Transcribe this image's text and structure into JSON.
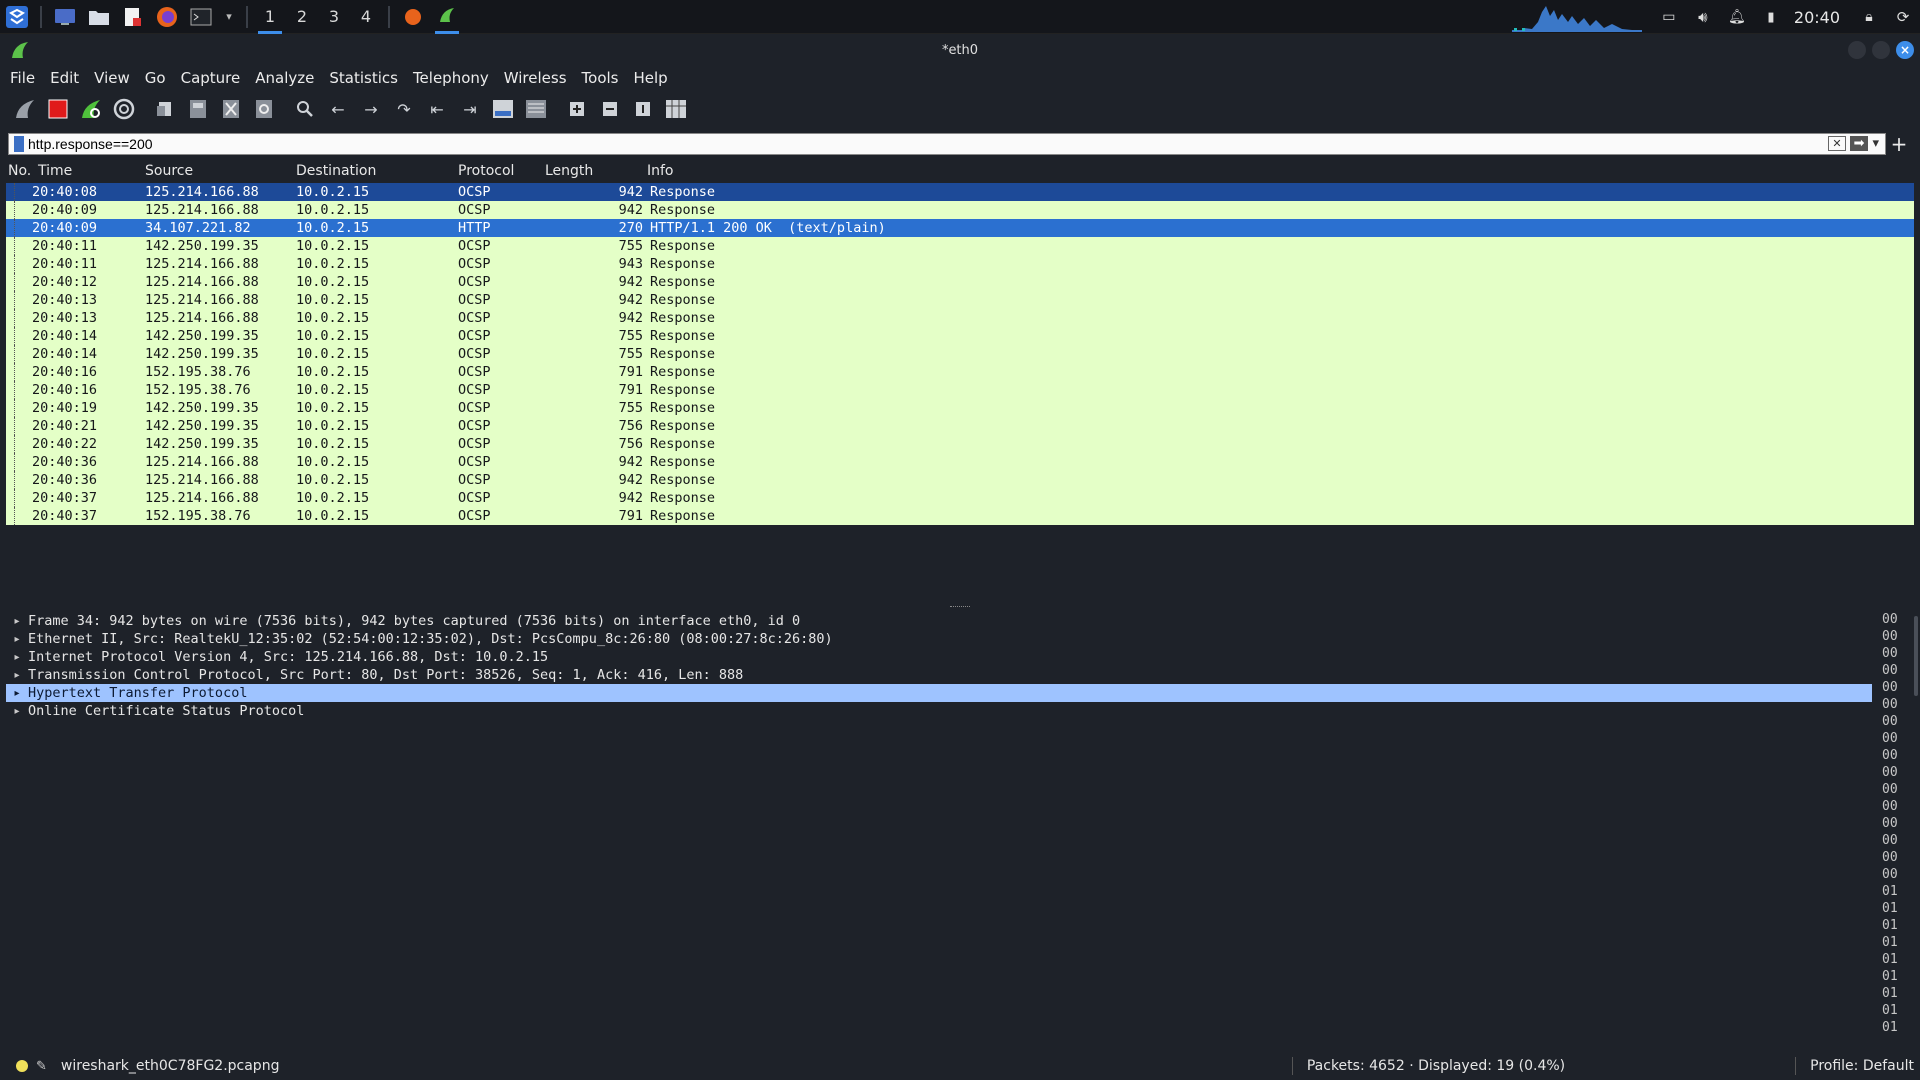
{
  "taskbar": {
    "workspaces": [
      "1",
      "2",
      "3",
      "4"
    ],
    "active_workspace": "1",
    "clock": "20:40"
  },
  "window": {
    "title": "*eth0"
  },
  "menu": [
    "File",
    "Edit",
    "View",
    "Go",
    "Capture",
    "Analyze",
    "Statistics",
    "Telephony",
    "Wireless",
    "Tools",
    "Help"
  ],
  "filter": {
    "value": "http.response==200"
  },
  "packet_list": {
    "columns": [
      "No.",
      "Time",
      "Source",
      "Destination",
      "Protocol",
      "Length",
      "Info"
    ],
    "rows": [
      {
        "time": "20:40:08",
        "src": "125.214.166.88",
        "dst": "10.0.2.15",
        "proto": "OCSP",
        "len": "942",
        "info": "Response",
        "state": "sel2"
      },
      {
        "time": "20:40:09",
        "src": "125.214.166.88",
        "dst": "10.0.2.15",
        "proto": "OCSP",
        "len": "942",
        "info": "Response",
        "state": "normal"
      },
      {
        "time": "20:40:09",
        "src": "34.107.221.82",
        "dst": "10.0.2.15",
        "proto": "HTTP",
        "len": "270",
        "info": "HTTP/1.1 200 OK  (text/plain)",
        "state": "sel"
      },
      {
        "time": "20:40:11",
        "src": "142.250.199.35",
        "dst": "10.0.2.15",
        "proto": "OCSP",
        "len": "755",
        "info": "Response",
        "state": "normal"
      },
      {
        "time": "20:40:11",
        "src": "125.214.166.88",
        "dst": "10.0.2.15",
        "proto": "OCSP",
        "len": "943",
        "info": "Response",
        "state": "normal"
      },
      {
        "time": "20:40:12",
        "src": "125.214.166.88",
        "dst": "10.0.2.15",
        "proto": "OCSP",
        "len": "942",
        "info": "Response",
        "state": "normal"
      },
      {
        "time": "20:40:13",
        "src": "125.214.166.88",
        "dst": "10.0.2.15",
        "proto": "OCSP",
        "len": "942",
        "info": "Response",
        "state": "normal"
      },
      {
        "time": "20:40:13",
        "src": "125.214.166.88",
        "dst": "10.0.2.15",
        "proto": "OCSP",
        "len": "942",
        "info": "Response",
        "state": "normal"
      },
      {
        "time": "20:40:14",
        "src": "142.250.199.35",
        "dst": "10.0.2.15",
        "proto": "OCSP",
        "len": "755",
        "info": "Response",
        "state": "normal"
      },
      {
        "time": "20:40:14",
        "src": "142.250.199.35",
        "dst": "10.0.2.15",
        "proto": "OCSP",
        "len": "755",
        "info": "Response",
        "state": "normal"
      },
      {
        "time": "20:40:16",
        "src": "152.195.38.76",
        "dst": "10.0.2.15",
        "proto": "OCSP",
        "len": "791",
        "info": "Response",
        "state": "normal"
      },
      {
        "time": "20:40:16",
        "src": "152.195.38.76",
        "dst": "10.0.2.15",
        "proto": "OCSP",
        "len": "791",
        "info": "Response",
        "state": "normal"
      },
      {
        "time": "20:40:19",
        "src": "142.250.199.35",
        "dst": "10.0.2.15",
        "proto": "OCSP",
        "len": "755",
        "info": "Response",
        "state": "normal"
      },
      {
        "time": "20:40:21",
        "src": "142.250.199.35",
        "dst": "10.0.2.15",
        "proto": "OCSP",
        "len": "756",
        "info": "Response",
        "state": "normal"
      },
      {
        "time": "20:40:22",
        "src": "142.250.199.35",
        "dst": "10.0.2.15",
        "proto": "OCSP",
        "len": "756",
        "info": "Response",
        "state": "normal"
      },
      {
        "time": "20:40:36",
        "src": "125.214.166.88",
        "dst": "10.0.2.15",
        "proto": "OCSP",
        "len": "942",
        "info": "Response",
        "state": "normal"
      },
      {
        "time": "20:40:36",
        "src": "125.214.166.88",
        "dst": "10.0.2.15",
        "proto": "OCSP",
        "len": "942",
        "info": "Response",
        "state": "normal"
      },
      {
        "time": "20:40:37",
        "src": "125.214.166.88",
        "dst": "10.0.2.15",
        "proto": "OCSP",
        "len": "942",
        "info": "Response",
        "state": "normal"
      },
      {
        "time": "20:40:37",
        "src": "152.195.38.76",
        "dst": "10.0.2.15",
        "proto": "OCSP",
        "len": "791",
        "info": "Response",
        "state": "normal"
      }
    ]
  },
  "details": [
    {
      "text": "Frame 34: 942 bytes on wire (7536 bits), 942 bytes captured (7536 bits) on interface eth0, id 0",
      "selected": false
    },
    {
      "text": "Ethernet II, Src: RealtekU_12:35:02 (52:54:00:12:35:02), Dst: PcsCompu_8c:26:80 (08:00:27:8c:26:80)",
      "selected": false
    },
    {
      "text": "Internet Protocol Version 4, Src: 125.214.166.88, Dst: 10.0.2.15",
      "selected": false
    },
    {
      "text": "Transmission Control Protocol, Src Port: 80, Dst Port: 38526, Seq: 1, Ack: 416, Len: 888",
      "selected": false
    },
    {
      "text": "Hypertext Transfer Protocol",
      "selected": true
    },
    {
      "text": "Online Certificate Status Protocol",
      "selected": false
    }
  ],
  "bytes": [
    "00",
    "00",
    "00",
    "00",
    "00",
    "00",
    "00",
    "00",
    "00",
    "00",
    "00",
    "00",
    "00",
    "00",
    "00",
    "00",
    "01",
    "01",
    "01",
    "01",
    "01",
    "01",
    "01",
    "01",
    "01"
  ],
  "status": {
    "file": "wireshark_eth0C78FG2.pcapng",
    "packets": "Packets: 4652 · Displayed: 19 (0.4%)",
    "profile": "Profile: Default"
  },
  "colors": {
    "row_bg": "#e4ffc7",
    "selected_row": "#2b70d0",
    "detail_selected": "#9ec3ff",
    "accent": "#3d8eea"
  }
}
